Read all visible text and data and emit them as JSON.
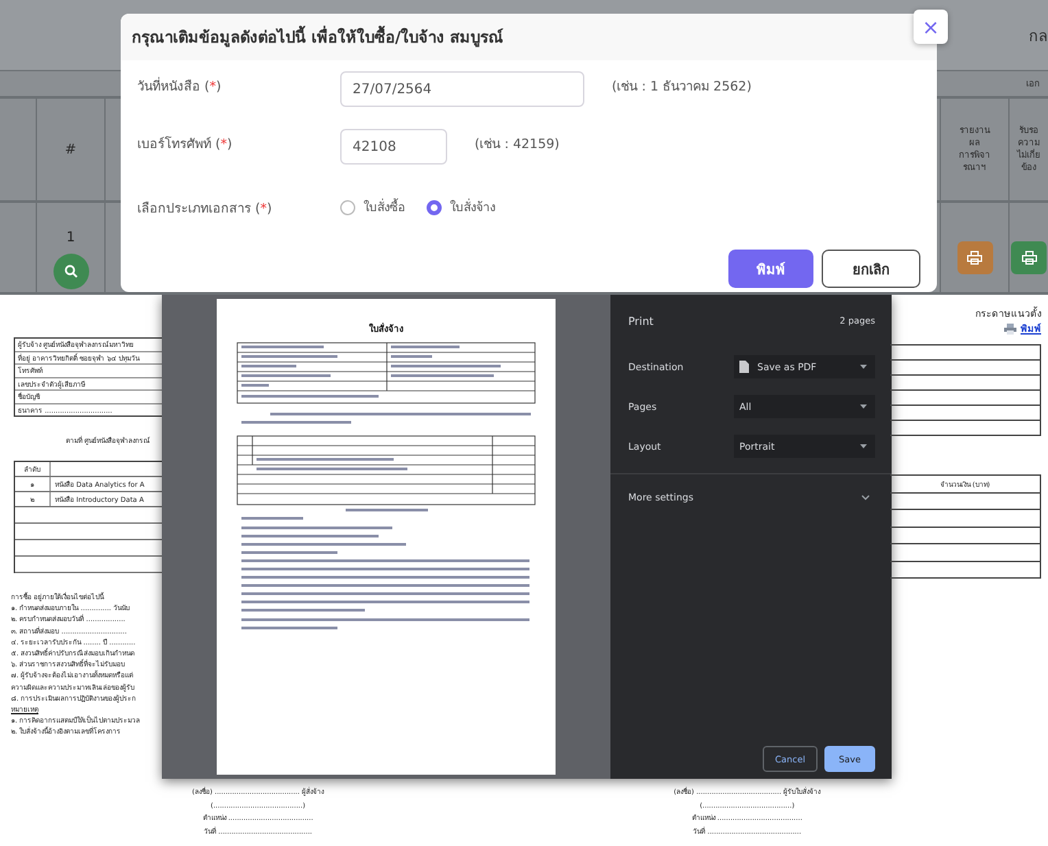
{
  "app": {
    "header_text": "กล",
    "group_header": "เอก",
    "columns": [
      {
        "label": "#"
      },
      {
        "label": "รายงาน ผล การพิจา รณาฯ"
      },
      {
        "label": "รับรอ ความ ไม่เกี่ย ข้อง"
      }
    ],
    "row_number": "1"
  },
  "dialog": {
    "title": "กรุณาเติมข้อมูลดังต่อไปนี้ เพื่อให้ใบซื้อ/ใบจ้าง สมบูรณ์",
    "close": "×",
    "fields": [
      {
        "kind": "date",
        "label": "วันที่หนังสือ",
        "required": [
          "(",
          "*",
          ")"
        ],
        "value": "27/07/2564",
        "example": "(เช่น : 1 ธันวาคม 2562)"
      },
      {
        "kind": "phone",
        "label": "เบอร์โทรศัพท์",
        "required": [
          "(",
          "*",
          ")"
        ],
        "value": "42108",
        "example": "(เช่น : 42159)"
      },
      {
        "kind": "radio",
        "label": "เลือกประเภทเอกสาร",
        "required": [
          "(",
          "*",
          ")"
        ],
        "options": [
          {
            "label": "ใบสั่งซื้อ",
            "selected": false
          },
          {
            "label": "ใบสั่งจ้าง",
            "selected": true
          }
        ]
      }
    ],
    "buttons": [
      {
        "label": "พิมพ์",
        "kind": "primary"
      },
      {
        "label": "ยกเลิก",
        "kind": "secondary"
      }
    ]
  },
  "print_dialog": {
    "title": "Print",
    "page_count": "2 pages",
    "preview_title": "ใบสั่งจ้าง",
    "settings": [
      {
        "label": "Destination",
        "value": "Save as PDF",
        "kind": "file"
      },
      {
        "label": "Pages",
        "value": "All",
        "kind": "plain"
      },
      {
        "label": "Layout",
        "value": "Portrait",
        "kind": "plain"
      }
    ],
    "more": "More settings",
    "buttons": [
      {
        "label": "Cancel",
        "kind": "secondary"
      },
      {
        "label": "Save",
        "kind": "primary"
      }
    ]
  },
  "document": {
    "vendor_rows": [
      "ผู้รับจ้าง ศูนย์หนังสือจุฬาลงกรณ์มหาวิทย",
      "ที่อยู่ อาคารวิทยกิตติ์ ซอยจุฬา ๖๔ ปทุมวัน",
      "โทรศัพท์",
      "เลขประจำตัวผู้เสียภาษี",
      "ชื่อบัญชี",
      "ธนาคาร ..............................."
    ],
    "intro": "ตามที่ ศูนย์หนังสือจุฬาลงกรณ์",
    "items_header": "ลำดับ",
    "items": [
      {
        "no": "๑",
        "name": "หนังสือ Data Analytics for A"
      },
      {
        "no": "๒",
        "name": "หนังสือ Introductory Data A"
      }
    ],
    "terms_title": "การซื้อ อยู่ภายใต้เงื่อนไขต่อไปนี้",
    "terms": [
      "๑. กำหนดส่งมอบภายใน .............. วันนับ",
      "๒. ครบกำหนดส่งมอบวันที่ ..................",
      "๓. สถานที่ส่งมอบ ..............................",
      "๔. ระยะเวลารับประกัน ........ ปี ............",
      "๕. สงวนสิทธิ์ค่าปรับกรณีส่งมอบเกินกำหนด",
      "๖. ส่วนราชการสงวนสิทธิ์ที่จะไม่รับมอบ",
      "๗. ผู้รับจ้างจะต้องไม่เอางานทั้งหมดหรือแต่",
      "ความผิดและความประมาทเลินเล่อของผู้รับ",
      "๘. การประเมินผลการปฏิบัติงานของผู้ประก"
    ],
    "notes_title": "หมายเหตุ",
    "notes": [
      "๑. การคิดอากรแสตมป์ให้เป็นไปตามประมวล",
      "๒. ใบสั่งจ้างนี้อ้างอิงตามเลขที่โครงการ"
    ],
    "orientation": "กระดาษแนวตั้ง",
    "print_link": "พิมพ์",
    "amount_header": "จำนวนเงิน (บาท)",
    "signatures": [
      {
        "lines": [
          "(ลงชื่อ) ....................................... ผู้สั่งจ้าง",
          "(.........................................)",
          "ตำแหน่ง .......................................",
          "วันที่ ..........................................."
        ]
      },
      {
        "lines": [
          "(ลงชื่อ) ....................................... ผู้รับใบสั่งจ้าง",
          "(.........................................)",
          "ตำแหน่ง .......................................",
          "วันที่ ..........................................."
        ]
      }
    ]
  }
}
